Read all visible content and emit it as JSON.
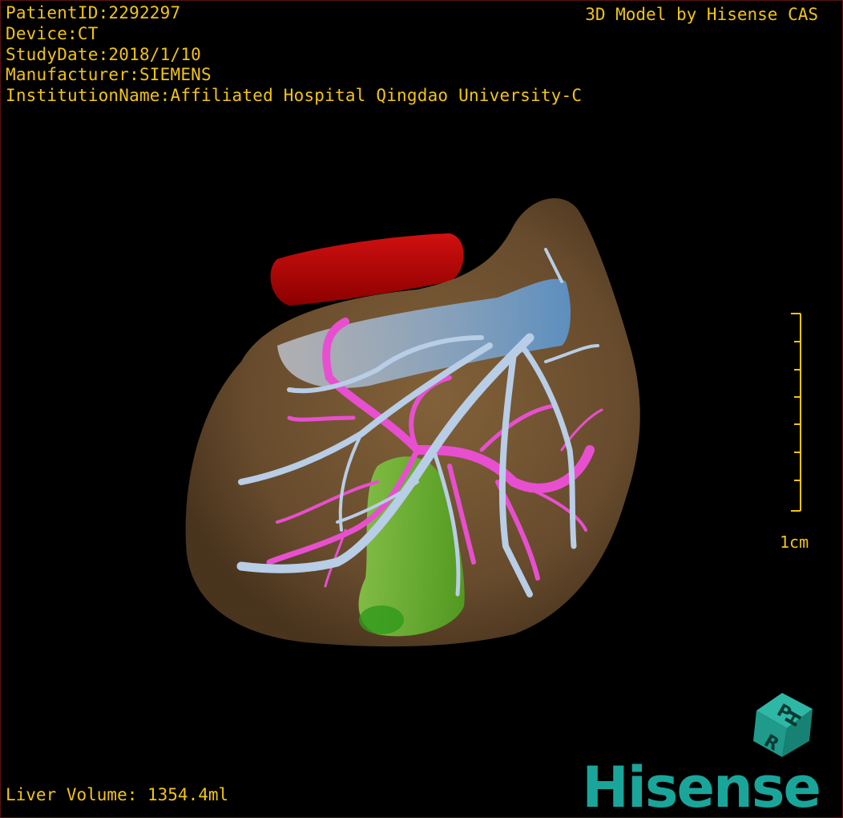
{
  "overlay": {
    "patient_id": "PatientID:2292297",
    "device": "Device:CT",
    "study_date": "StudyDate:2018/1/10",
    "manufacturer": "Manufacturer:SIEMENS",
    "institution": "InstitutionName:Affiliated Hospital Qingdao University-C",
    "watermark": "3D Model by Hisense CAS",
    "liver_volume": "Liver Volume: 1354.4ml"
  },
  "scale": {
    "label": "1cm"
  },
  "orientation_cube": {
    "faces": [
      "P",
      "R",
      "H"
    ]
  },
  "brand": {
    "name": "Hisense"
  },
  "colors": {
    "overlay_text": "#f2c414",
    "liver": "#7a5a34",
    "hepatic_vein": "#b8cde6",
    "portal_vein": "#e84fd0",
    "ivc": "#b50000",
    "gallbladder": "#6cc22a",
    "brand": "#1aa59a"
  }
}
